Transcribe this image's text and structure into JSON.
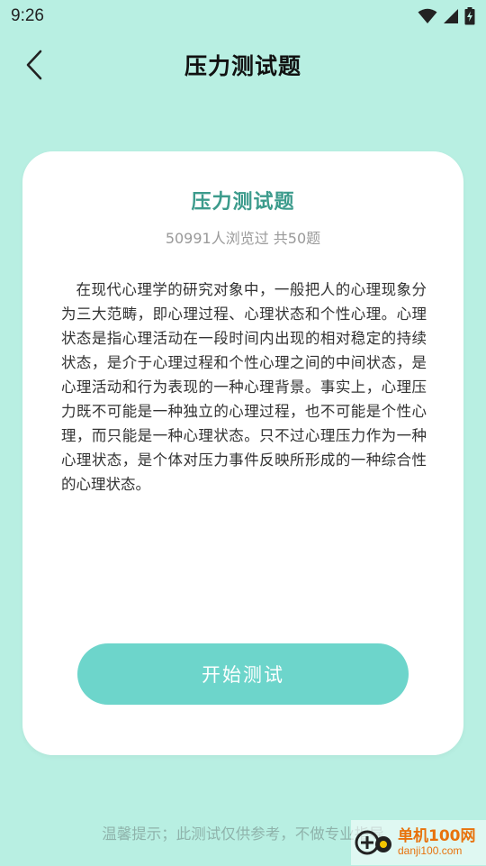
{
  "status_bar": {
    "time": "9:26",
    "icons": [
      "wifi-icon",
      "cellular-signal-icon",
      "battery-charging-icon"
    ]
  },
  "header": {
    "title": "压力测试题",
    "back_icon": "chevron-left-icon"
  },
  "card": {
    "title": "压力测试题",
    "stats": "50991人浏览过 共50题",
    "description": "在现代心理学的研究对象中，一般把人的心理现象分为三大范畴，即心理过程、心理状态和个性心理。心理状态是指心理活动在一段时间内出现的相对稳定的持续状态，是介于心理过程和个性心理之间的中间状态，是心理活动和行为表现的一种心理背景。事实上，心理压力既不可能是一种独立的心理过程，也不可能是个性心理，而只能是一种心理状态。只不过心理压力作为一种心理状态，是个体对压力事件反映所形成的一种综合性的心理状态。",
    "start_button": "开始测试"
  },
  "footer": {
    "tip": "温馨提示；此测试仅供参考，不做专业指导"
  },
  "watermark": {
    "name": "单机100网",
    "url": "danji100.com"
  },
  "colors": {
    "background": "#b8efe2",
    "accent": "#3c9b8c",
    "button": "#6dd5cb",
    "watermark": "#e8720c"
  }
}
